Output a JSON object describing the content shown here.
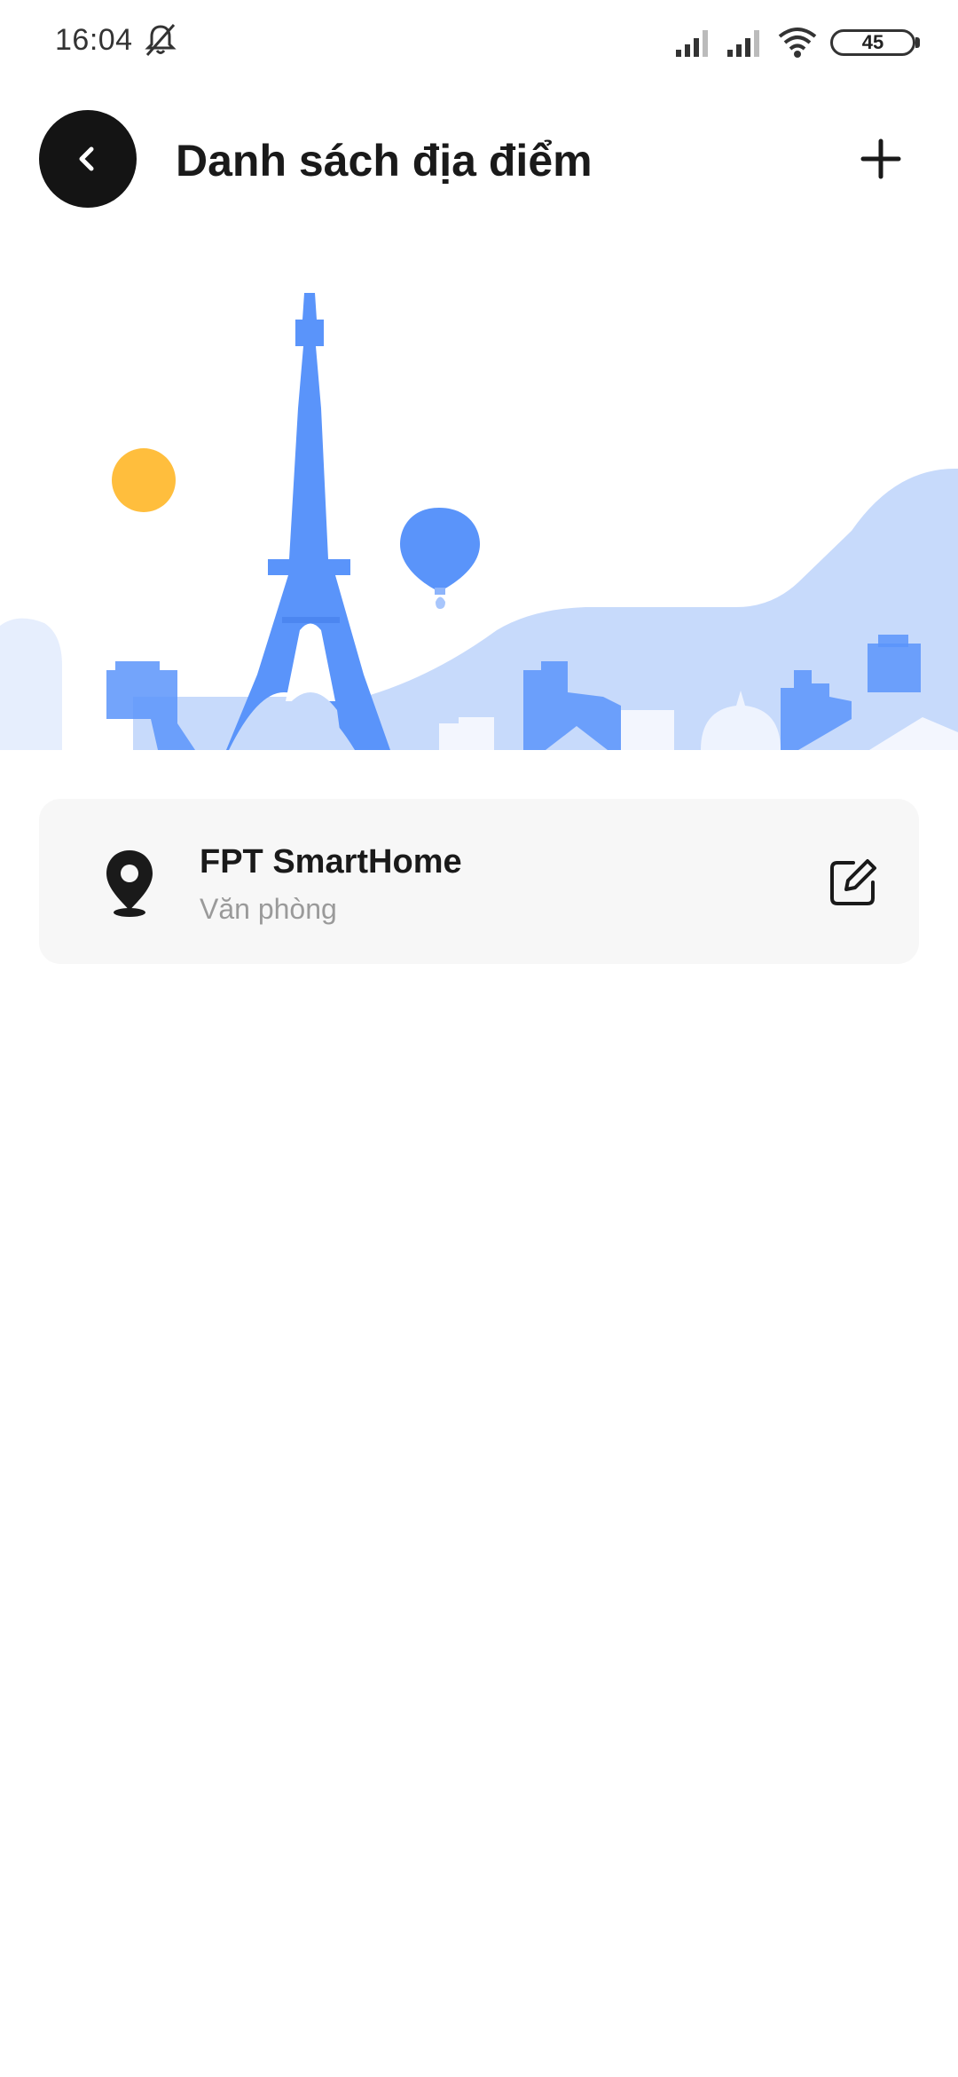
{
  "status_bar": {
    "time": "16:04",
    "battery": "45",
    "icons": [
      "notifications-muted-icon",
      "signal-icon",
      "signal-icon",
      "wifi-icon",
      "battery-icon"
    ]
  },
  "header": {
    "title": "Danh sách địa điểm",
    "back_icon": "chevron-left-icon",
    "add_icon": "plus-icon"
  },
  "banner": {
    "illustration": "paris-skyline-illustration",
    "colors": {
      "sun": "#FFBE3D",
      "primary_blue": "#5A94FA",
      "light_blue": "#C7DAFB",
      "pale_blue": "#E6EEFD"
    }
  },
  "locations": [
    {
      "name": "FPT SmartHome",
      "type": "Văn phòng",
      "icon": "location-pin-icon",
      "action_icon": "edit-icon"
    }
  ]
}
